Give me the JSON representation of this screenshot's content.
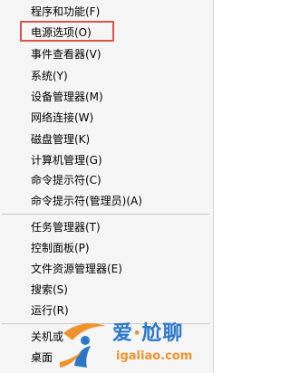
{
  "menu": {
    "items": [
      {
        "label": "程序和功能(F)"
      },
      {
        "label": "电源选项(O)"
      },
      {
        "label": "事件查看器(V)"
      },
      {
        "label": "系统(Y)"
      },
      {
        "label": "设备管理器(M)"
      },
      {
        "label": "网络连接(W)"
      },
      {
        "label": "磁盘管理(K)"
      },
      {
        "label": "计算机管理(G)"
      },
      {
        "label": "命令提示符(C)"
      },
      {
        "label": "命令提示符(管理员)(A)"
      },
      {
        "label": "任务管理器(T)"
      },
      {
        "label": "控制面板(P)"
      },
      {
        "label": "文件资源管理器(E)"
      },
      {
        "label": "搜索(S)"
      },
      {
        "label": "运行(R)"
      },
      {
        "label": "关机或"
      },
      {
        "label": "桌面"
      }
    ],
    "highlighted_item": "电源选项(O)",
    "highlight_color": "#d9534f"
  },
  "watermark": {
    "brand_left": "爱",
    "brand_dot": "·",
    "brand_right": "尬聊",
    "url": "igaliao.com",
    "colors": {
      "blue": "#2a77c9",
      "orange": "#f0932e"
    }
  }
}
